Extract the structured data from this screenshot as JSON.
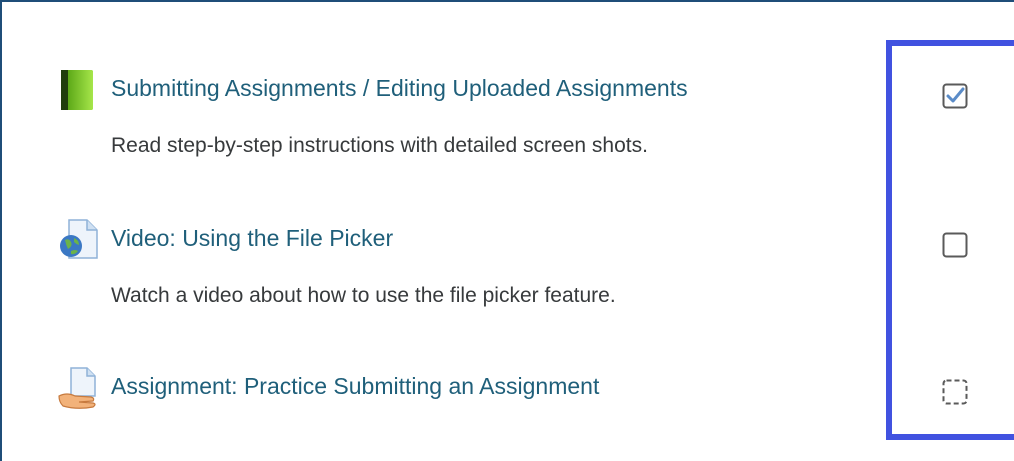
{
  "activities": [
    {
      "title": "Submitting Assignments / Editing Uploaded Assignments",
      "description": "Read step-by-step instructions with detailed screen shots.",
      "icon": "book-icon",
      "completion": "completed"
    },
    {
      "title": "Video: Using the File Picker",
      "description": "Watch a video about how to use the file picker feature.",
      "icon": "url-globe-icon",
      "completion": "not-completed"
    },
    {
      "title": "Assignment: Practice Submitting an Assignment",
      "description": "",
      "icon": "assignment-hand-icon",
      "completion": "automatic-not-completed"
    }
  ],
  "colors": {
    "link": "#1f5f7a",
    "text": "#373a3c",
    "highlight_border": "#4152e0",
    "frame_border": "#1f4e79",
    "checkbox": "#5a5a5a",
    "checkmark": "#5b8cc8"
  }
}
